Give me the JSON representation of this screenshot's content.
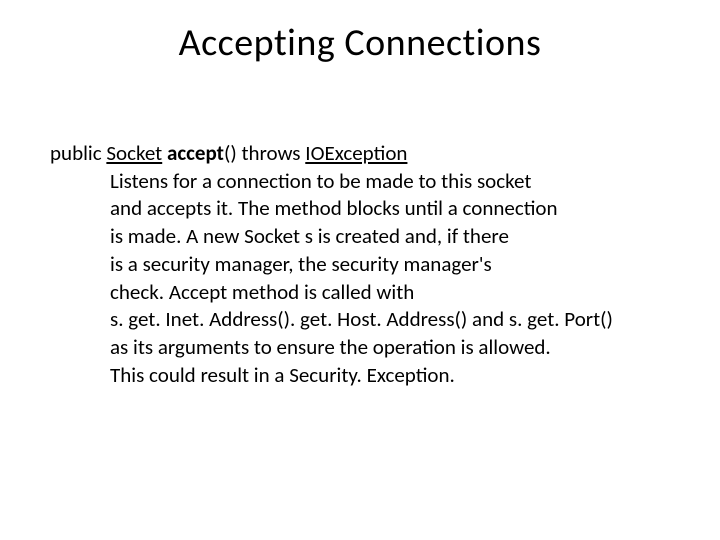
{
  "title": "Accepting Connections",
  "signature": {
    "kw_public": "public ",
    "ret_type": "Socket",
    "space1": " ",
    "method": "accept",
    "parens": "() ",
    "kw_throws": "throws ",
    "exc": "IOException"
  },
  "description_lines": [
    "Listens for a connection to be made to this socket",
    "and accepts it. The method blocks until a connection",
    "is made. A new Socket s is created and, if there",
    "is a security manager, the security manager's",
    "check. Accept method is called with",
    "s. get. Inet. Address(). get. Host. Address() and s. get. Port()",
    "as its arguments to ensure the operation is allowed.",
    "This could result in a Security. Exception."
  ]
}
